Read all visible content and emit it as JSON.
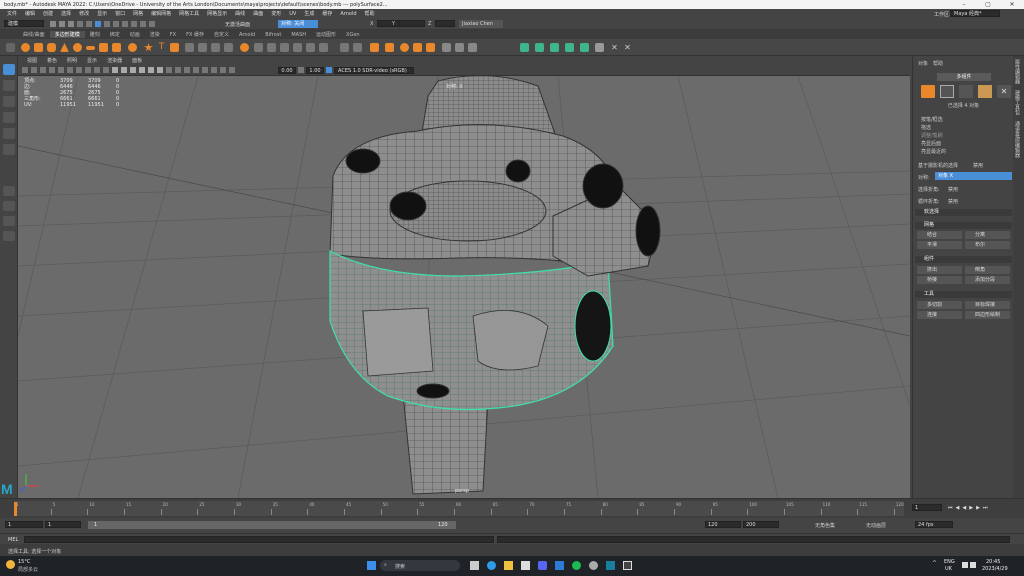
{
  "titlebar": {
    "title": "body.mb* - Autodesk MAYA 2022: C:\\Users\\OneDrive - University of the Arts London\\Documents\\maya\\projects\\default\\scenes\\body.mb  ---  polySurface2..."
  },
  "menubar": {
    "items": [
      "文件",
      "编辑",
      "创建",
      "选择",
      "修改",
      "显示",
      "窗口",
      "网格",
      "编辑网格",
      "网格工具",
      "网格显示",
      "曲线",
      "曲面",
      "变形",
      "UV",
      "生成",
      "缓存",
      "Arnold",
      "帮助"
    ],
    "workspace_label": "工作区:",
    "workspace_value": "Maya 经典*"
  },
  "statusline": {
    "mode": "建模",
    "no_live": "无激活曲面",
    "sym_label": "对称: 关闭",
    "x_label": "X",
    "y_label": "Y",
    "z_label": "Z",
    "user": "Jiaxiao Chen"
  },
  "shelf": {
    "tabs": [
      "曲线/曲面",
      "多边形建模",
      "雕刻",
      "绑定",
      "动画",
      "渲染",
      "FX",
      "FX 缓存",
      "自定义",
      "Arnold",
      "Bifrost",
      "MASH",
      "运动图形",
      "XGen"
    ],
    "active_tab": 1
  },
  "viewport": {
    "menu": [
      "视图",
      "着色",
      "照明",
      "显示",
      "渲染器",
      "面板"
    ],
    "exposure": "0.00",
    "gamma": "1.00",
    "colorspace": "ACES 1.0 SDR-video (sRGB)",
    "hud": [
      {
        "k": "顶点:",
        "v": "3709",
        "v2": "3709",
        "v3": "0"
      },
      {
        "k": "边:",
        "v": "6446",
        "v2": "6446",
        "v3": "0"
      },
      {
        "k": "面:",
        "v": "2675",
        "v2": "2675",
        "v3": "0"
      },
      {
        "k": "三角形:",
        "v": "6661",
        "v2": "6661",
        "v3": "0"
      },
      {
        "k": "UV:",
        "v": "11951",
        "v2": "11951",
        "v3": "0"
      }
    ],
    "camera_label": "persp",
    "top_label": "对称: X"
  },
  "rightpanel": {
    "tabs": [
      "对象",
      "帮助"
    ],
    "multi_button": "多组件",
    "selected_text": "已选择 4 对象",
    "options": [
      "按笔/框选",
      "拖选",
      "调整/笔刷",
      "亮显后面",
      "亮显最近的"
    ],
    "based_on": "基于摄影机的选择",
    "based_on_value": "禁用",
    "sym_label": "对称:",
    "sym_value": "对象 X",
    "select_by_angle_label": "选择折角:",
    "select_by_angle_value": "禁用",
    "step_label": "循环折角:",
    "step_value": "禁用",
    "sections": {
      "soft": "软选择",
      "mesh": "网格",
      "component": "组件",
      "tools": "工具"
    },
    "mesh_buttons": [
      "结合",
      "分离",
      "平滑",
      "布尔"
    ],
    "component_buttons": [
      "挤出",
      "倒角",
      "桥接",
      "添加分段"
    ],
    "tool_buttons": [
      "多切割",
      "目标焊接",
      "连接",
      "四边形绘制"
    ]
  },
  "sidetabs": [
    "属性编辑器",
    "建模工具包",
    "通道盒/层编辑器"
  ],
  "timeslider": {
    "ticks": [
      "1",
      "5",
      "10",
      "15",
      "20",
      "25",
      "30",
      "35",
      "40",
      "45",
      "50",
      "55",
      "60",
      "65",
      "70",
      "75",
      "80",
      "85",
      "90",
      "95",
      "100",
      "105",
      "110",
      "115",
      "120"
    ],
    "current": "1"
  },
  "rangebar": {
    "start": "1",
    "start2": "1",
    "range_mid": "1",
    "range_end": "120",
    "end": "120",
    "anim_end": "200",
    "char_set": "无角色集",
    "anim_layer": "无动画层",
    "fps": "24 fps"
  },
  "cmdline": {
    "label": "MEL"
  },
  "helpline": {
    "text": "选择工具: 选择一个对象"
  },
  "taskbar": {
    "weather_temp": "15°C",
    "weather_desc": "局部多云",
    "search": "搜索",
    "lang": "ENG",
    "lang2": "UK",
    "time": "20:45",
    "date": "2023/4/29"
  },
  "colors": {
    "mesh": "#8f8f8f",
    "wire": "#3a3a3a",
    "selected_wire": "#3fe0a8",
    "accent_blue": "#4a8ed8",
    "orange": "#e8872b"
  }
}
